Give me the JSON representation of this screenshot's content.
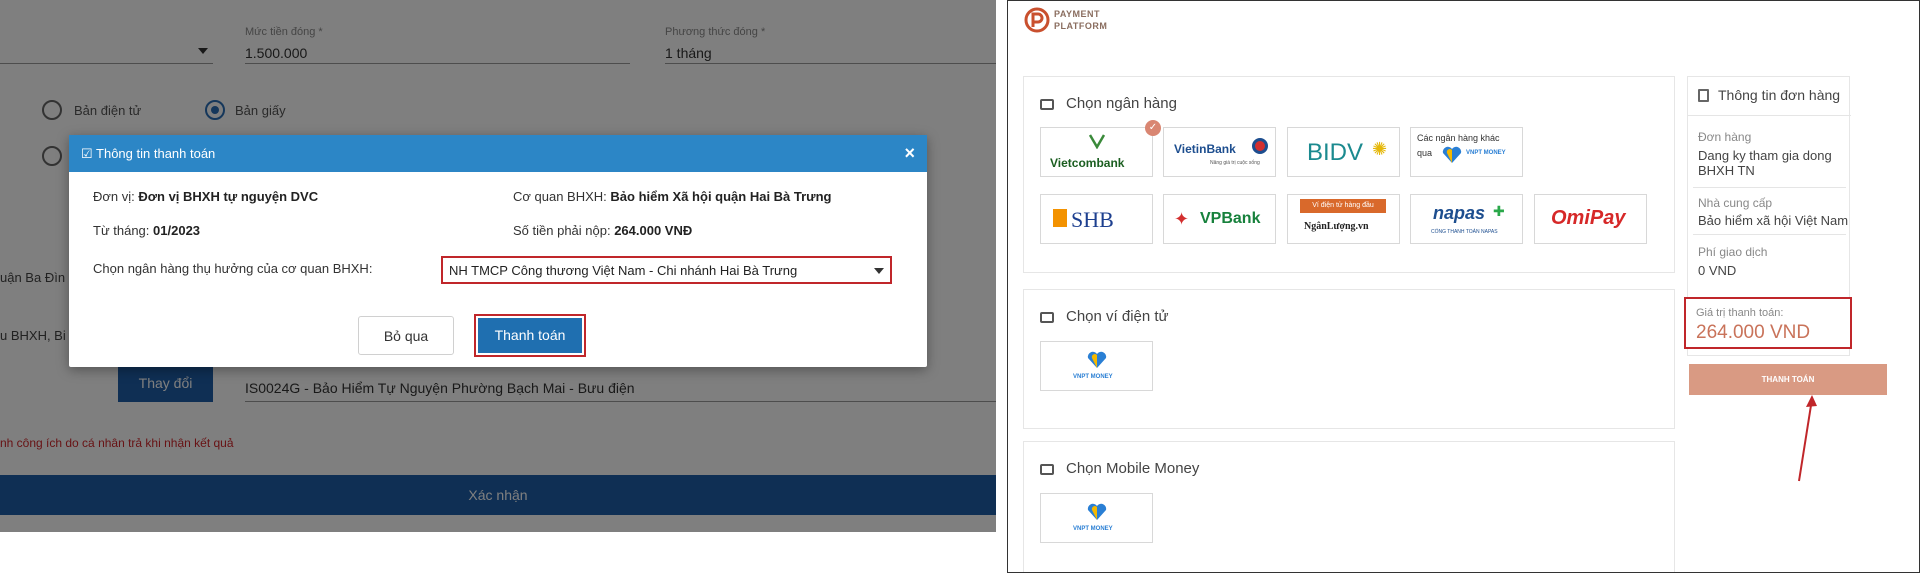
{
  "left": {
    "form": {
      "amount_label": "Mức tiền đóng *",
      "amount_value": "1.500.000",
      "method_label": "Phương thức đóng *",
      "method_value": "1 tháng",
      "radio_electronic": "Bản điện tử",
      "radio_paper": "Bản giấy",
      "address_fragment": "uận Ba Đìn",
      "bhxh_fragment": "u BHXH, Bi",
      "change_button": "Thay đổi",
      "agency_value": "IS0024G - Bảo Hiểm Tự Nguyện Phường Bạch Mai - Bưu điện",
      "notice_text": "nh công ích do cá nhân trả khi nhận kết quả",
      "confirm_button": "Xác nhận"
    },
    "modal": {
      "title": "Thông tin thanh toán",
      "close": "×",
      "unit_label": "Đơn vị:",
      "unit_value": "Đơn vị BHXH tự nguyện DVC",
      "agency_label": "Cơ quan BHXH:",
      "agency_value": "Bảo hiểm Xã hội quận Hai Bà Trưng",
      "from_month_label": "Từ tháng:",
      "from_month_value": "01/2023",
      "amount_due_label": "Số tiền phải nộp:",
      "amount_due_value": "264.000 VNĐ",
      "bank_select_label": "Chọn ngân hàng thụ hưởng của cơ quan BHXH:",
      "bank_select_value": "NH TMCP Công thương Việt Nam - Chi nhánh Hai Bà Trưng",
      "skip_button": "Bỏ qua",
      "pay_button": "Thanh toán"
    }
  },
  "right": {
    "logo": {
      "line1": "PAYMENT",
      "line2": "PLATFORM"
    },
    "choose_bank": "Chọn ngân hàng",
    "banks": {
      "vietcombank": "Vietcombank",
      "vietinbank": "VietinBank",
      "vietinbank_sub": "Nâng giá trị cuộc sống",
      "bidv": "BIDV",
      "other_line1": "Các ngân hàng khác",
      "other_line2": "qua",
      "vnpt_money": "VNPT MONEY",
      "shb": "SHB",
      "vpbank": "VPBank",
      "nganluong_top": "Ví điện tử hàng đầu",
      "nganluong": "NgânLượng.vn",
      "napas": "napas",
      "napas_sub": "CỔNG THANH TOÁN NAPAS",
      "omipay": "OmiPay"
    },
    "choose_wallet": "Chọn ví điện tử",
    "choose_mobile_money": "Chọn Mobile Money",
    "order": {
      "title": "Thông tin đơn hàng",
      "order_label": "Đơn hàng",
      "order_value": "Dang ky tham gia dong BHXH TN",
      "provider_label": "Nhà cung cấp",
      "provider_value": "Bảo hiểm xã hội Việt Nam",
      "fee_label": "Phí giao dịch",
      "fee_value": "0 VND",
      "total_label": "Giá trị thanh toán:",
      "total_value": "264.000 VND",
      "pay_button": "THANH TOÁN"
    }
  },
  "colors": {
    "modal_header": "#2c86c6",
    "primary_blue": "#1f5fa8",
    "highlight_red": "#c0262a",
    "pay_button": "#d99a83"
  }
}
